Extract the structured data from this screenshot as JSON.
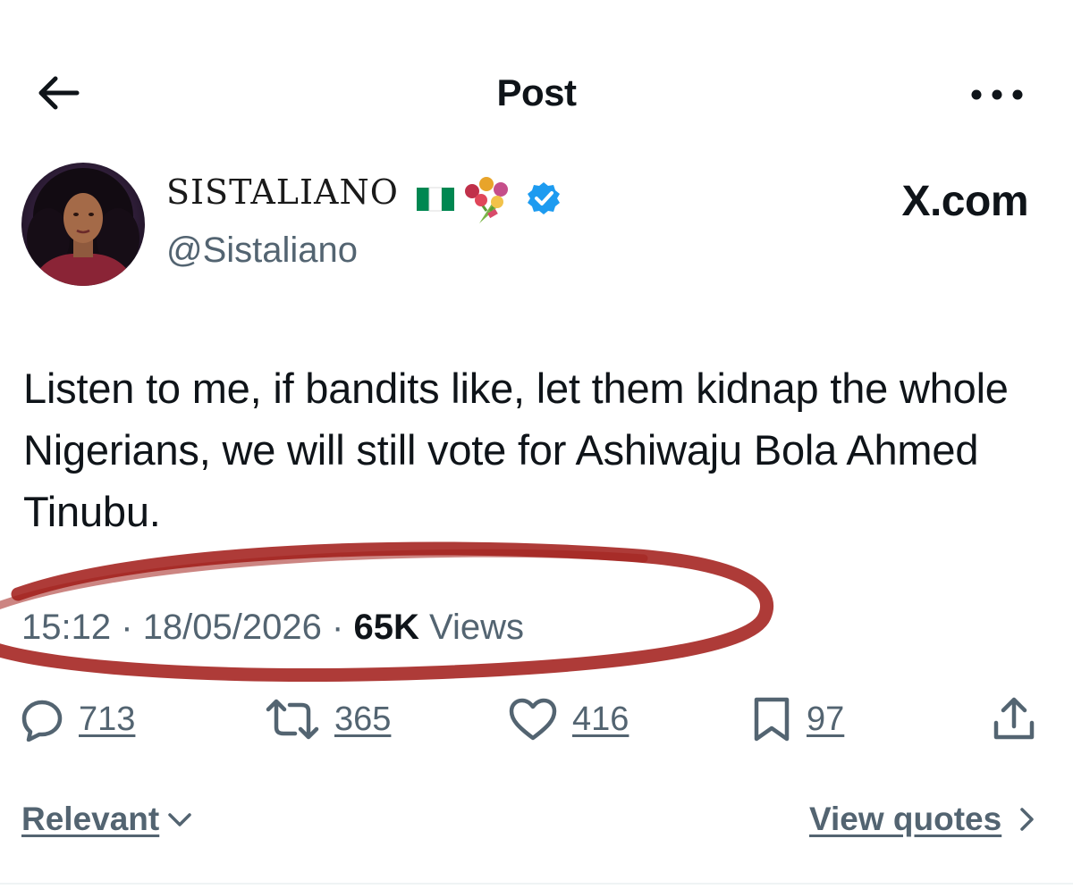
{
  "header": {
    "title": "Post",
    "back_icon": "arrow-left-icon",
    "more_icon": "more-horizontal-icon"
  },
  "author": {
    "display_name": "SISTALIANO",
    "name_emojis": [
      "nigeria-flag-icon",
      "bouquet-icon"
    ],
    "verified": true,
    "handle": "@Sistaliano"
  },
  "watermark": "X.com",
  "tweet": {
    "text": "Listen to me, if bandits like, let them kidnap the whole Nigerians, we will still vote for Ashiwaju Bola Ahmed Tinubu."
  },
  "meta": {
    "time": "15:12",
    "separator": "·",
    "date": "18/05/2026",
    "views_count": "65K",
    "views_label": "Views"
  },
  "actions": {
    "replies": "713",
    "reposts": "365",
    "likes": "416",
    "bookmarks": "97"
  },
  "footer": {
    "sort_label": "Relevant",
    "quotes_label": "View quotes"
  },
  "colors": {
    "text_primary": "#0f1419",
    "text_secondary": "#536471",
    "verified_blue": "#1d9bf0",
    "annotation_red": "#a3201c"
  }
}
